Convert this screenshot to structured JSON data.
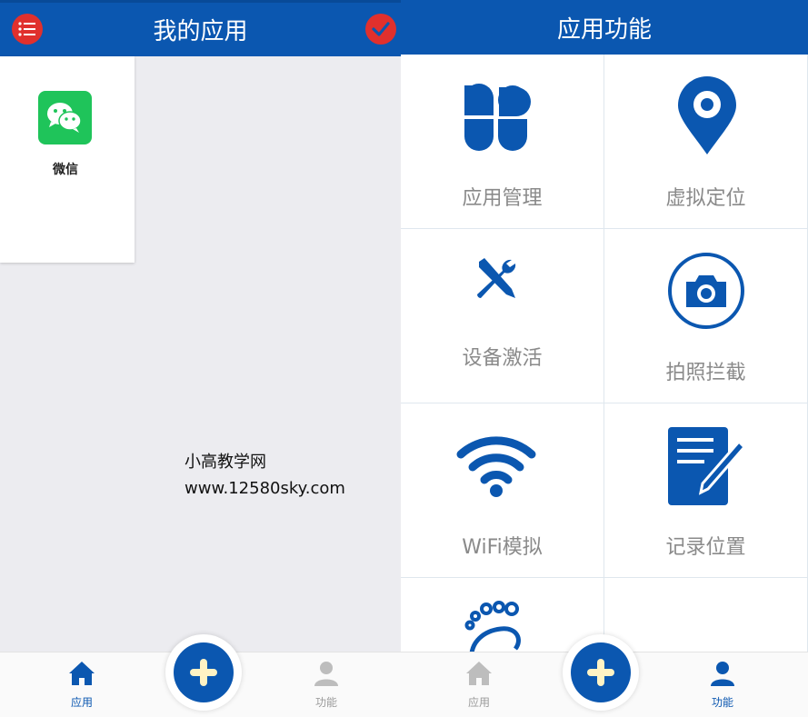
{
  "left_screen": {
    "title": "我的应用",
    "apps": [
      {
        "name": "微信",
        "icon": "wechat-icon"
      }
    ],
    "watermark": {
      "line1": "小高教学网",
      "line2": "www.12580sky.com"
    },
    "tabs": [
      {
        "label": "应用",
        "icon": "home-icon",
        "active": true
      },
      {
        "label": "功能",
        "icon": "person-icon",
        "active": false
      }
    ]
  },
  "right_screen": {
    "title": "应用功能",
    "features": [
      {
        "label": "应用管理",
        "icon": "four-petal-grid-icon"
      },
      {
        "label": "虚拟定位",
        "icon": "location-pin-icon"
      },
      {
        "label": "设备激活",
        "icon": "tools-icon"
      },
      {
        "label": "拍照拦截",
        "icon": "camera-icon"
      },
      {
        "label": "WiFi模拟",
        "icon": "wifi-icon"
      },
      {
        "label": "记录位置",
        "icon": "notepad-pen-icon"
      },
      {
        "label": "",
        "icon": "footprint-icon"
      }
    ],
    "tabs": [
      {
        "label": "应用",
        "icon": "home-icon",
        "active": false
      },
      {
        "label": "功能",
        "icon": "person-icon",
        "active": true
      }
    ]
  },
  "colors": {
    "primary": "#0b57b0",
    "accent_red": "#e0302d",
    "wechat_green": "#1fc45a",
    "fab_plus": "#fff3c4"
  }
}
